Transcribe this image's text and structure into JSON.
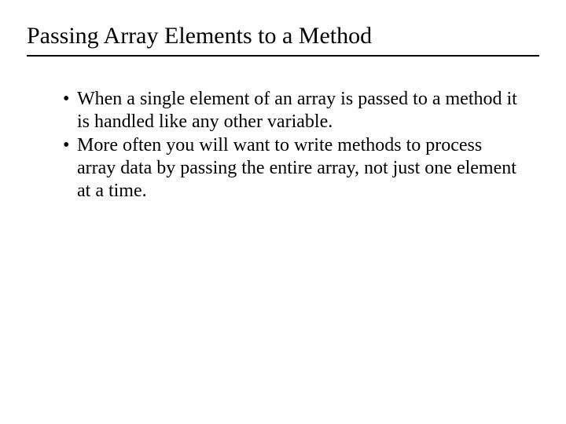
{
  "title": "Passing Array Elements to a Method",
  "bullets": [
    "When a single element of an array is passed to a method it is handled like any other variable.",
    "More often you will want to write methods to process array data by passing the entire array, not just one element at a time."
  ],
  "bullet_glyph": "•"
}
